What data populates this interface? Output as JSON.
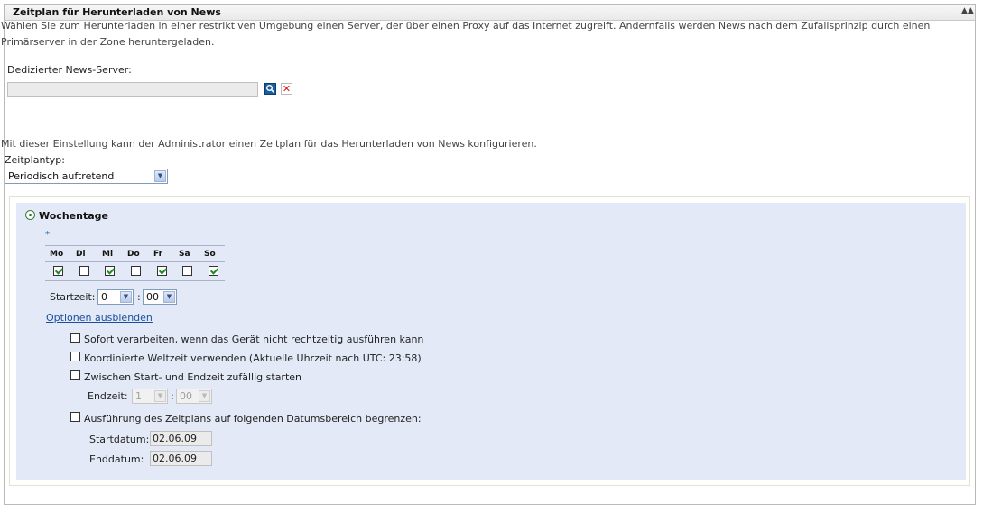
{
  "panel": {
    "title": "Zeitplan für Herunterladen von News",
    "collapse_icon": "double-chevron-up-icon"
  },
  "server_section": {
    "description_line1": "Wählen Sie zum Herunterladen in einer restriktiven Umgebung einen Server, der über einen Proxy auf das Internet zugreift. Andernfalls werden News nach dem Zufallsprinzip durch einen",
    "description_line2": "Primärserver in der Zone heruntergeladen.",
    "label": "Dedizierter News-Server:",
    "value": "",
    "search_icon": "search-icon",
    "clear_icon": "clear-x-icon"
  },
  "schedule": {
    "description": "Mit dieser Einstellung kann der Administrator einen Zeitplan für das Herunterladen von News konfigurieren.",
    "type_label": "Zeitplantyp:",
    "type_value": "Periodisch auftretend",
    "weekdays": {
      "radio_label": "Wochentage",
      "required_marker": "*",
      "days": [
        {
          "label": "Mo",
          "checked": true
        },
        {
          "label": "Di",
          "checked": false
        },
        {
          "label": "Mi",
          "checked": true
        },
        {
          "label": "Do",
          "checked": false
        },
        {
          "label": "Fr",
          "checked": true
        },
        {
          "label": "Sa",
          "checked": false
        },
        {
          "label": "So",
          "checked": true
        }
      ],
      "start_time_label": "Startzeit:",
      "start_hour": "0",
      "start_minute": "00",
      "time_separator": ":",
      "hide_options_link": "Optionen ausblenden"
    },
    "options": {
      "process_immediately": {
        "label": "Sofort verarbeiten, wenn das Gerät nicht rechtzeitig ausführen kann",
        "checked": false
      },
      "use_utc": {
        "label": "Koordinierte Weltzeit verwenden (Aktuelle Uhrzeit nach UTC: 23:58)",
        "checked": false
      },
      "random_start": {
        "label": "Zwischen Start- und Endzeit zufällig starten",
        "checked": false
      },
      "end_time_label": "Endzeit:",
      "end_hour": "1",
      "end_minute": "00",
      "restrict_dates": {
        "label": "Ausführung des Zeitplans auf folgenden Datumsbereich begrenzen:",
        "checked": false
      },
      "start_date_label": "Startdatum:",
      "start_date": "02.06.09",
      "end_date_label": "Enddatum:",
      "end_date": "02.06.09"
    }
  },
  "colors": {
    "link": "#1a4fa0",
    "inner_background": "#e3e9f6",
    "check": "#1f8a1f"
  }
}
